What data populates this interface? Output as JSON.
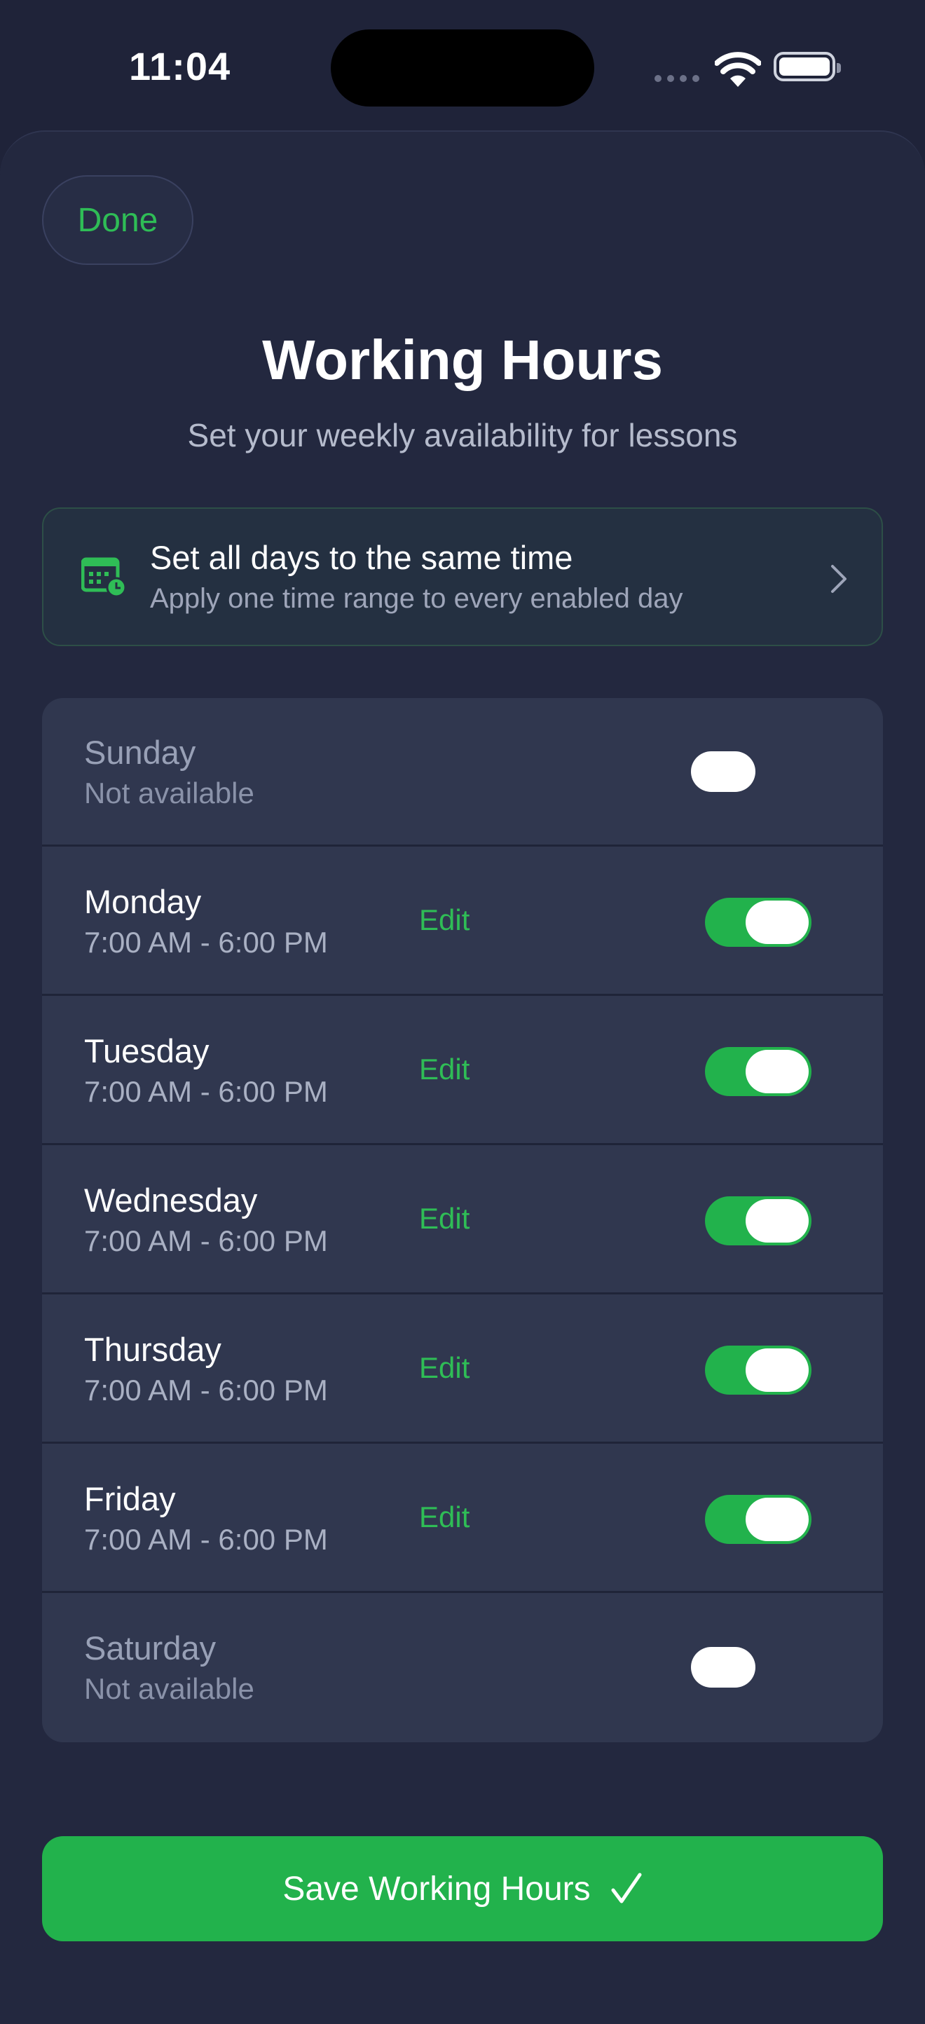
{
  "status_bar": {
    "time": "11:04"
  },
  "header": {
    "done_label": "Done",
    "title": "Working Hours",
    "subtitle": "Set your weekly availability for lessons"
  },
  "bulk_action": {
    "title": "Set all days to the same time",
    "subtitle": "Apply one time range to every enabled day",
    "icon": "calendar-clock-icon"
  },
  "days": [
    {
      "name": "Sunday",
      "hours": "Not available",
      "enabled": false,
      "edit_label": ""
    },
    {
      "name": "Monday",
      "hours": "7:00 AM - 6:00 PM",
      "enabled": true,
      "edit_label": "Edit"
    },
    {
      "name": "Tuesday",
      "hours": "7:00 AM - 6:00 PM",
      "enabled": true,
      "edit_label": "Edit"
    },
    {
      "name": "Wednesday",
      "hours": "7:00 AM - 6:00 PM",
      "enabled": true,
      "edit_label": "Edit"
    },
    {
      "name": "Thursday",
      "hours": "7:00 AM - 6:00 PM",
      "enabled": true,
      "edit_label": "Edit"
    },
    {
      "name": "Friday",
      "hours": "7:00 AM - 6:00 PM",
      "enabled": true,
      "edit_label": "Edit"
    },
    {
      "name": "Saturday",
      "hours": "Not available",
      "enabled": false,
      "edit_label": ""
    }
  ],
  "footer": {
    "save_label": "Save Working Hours"
  },
  "colors": {
    "accent": "#22b24c",
    "background": "#1f2339",
    "card": "#30374f"
  }
}
